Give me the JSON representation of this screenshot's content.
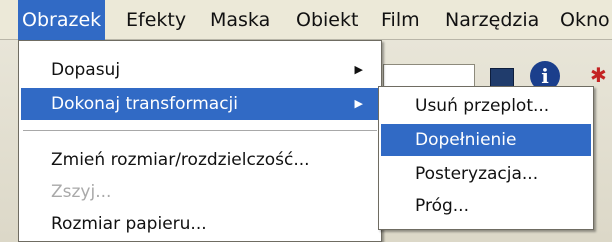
{
  "menubar": {
    "items": [
      {
        "label": "Obrazek",
        "active": true
      },
      {
        "label": "Efekty"
      },
      {
        "label": "Maska"
      },
      {
        "label": "Obiekt"
      },
      {
        "label": "Film"
      },
      {
        "label": "Narzędzia"
      },
      {
        "label": "Okno"
      }
    ]
  },
  "main_menu": {
    "items": [
      {
        "label": "Dopasuj",
        "has_submenu": true
      },
      {
        "label": "Dokonaj transformacji",
        "has_submenu": true,
        "highlighted": true
      },
      {
        "label": "Zmień rozmiar/rozdzielczość..."
      },
      {
        "label": "Zszyj...",
        "disabled": true
      },
      {
        "label": "Rozmiar papieru..."
      }
    ],
    "submenu_arrow": "▶"
  },
  "sub_menu": {
    "items": [
      {
        "label": "Usuń przeplot..."
      },
      {
        "label": "Dopełnienie",
        "highlighted": true
      },
      {
        "label": "Posteryzacja..."
      },
      {
        "label": "Próg..."
      }
    ]
  },
  "background_icons": {
    "info_icon_glyph": "i",
    "close_icon_glyph": "✱"
  },
  "colors": {
    "highlight": "#316ac5",
    "menubar_bg": "#ece9d8",
    "disabled_text": "#a9a9a9"
  }
}
